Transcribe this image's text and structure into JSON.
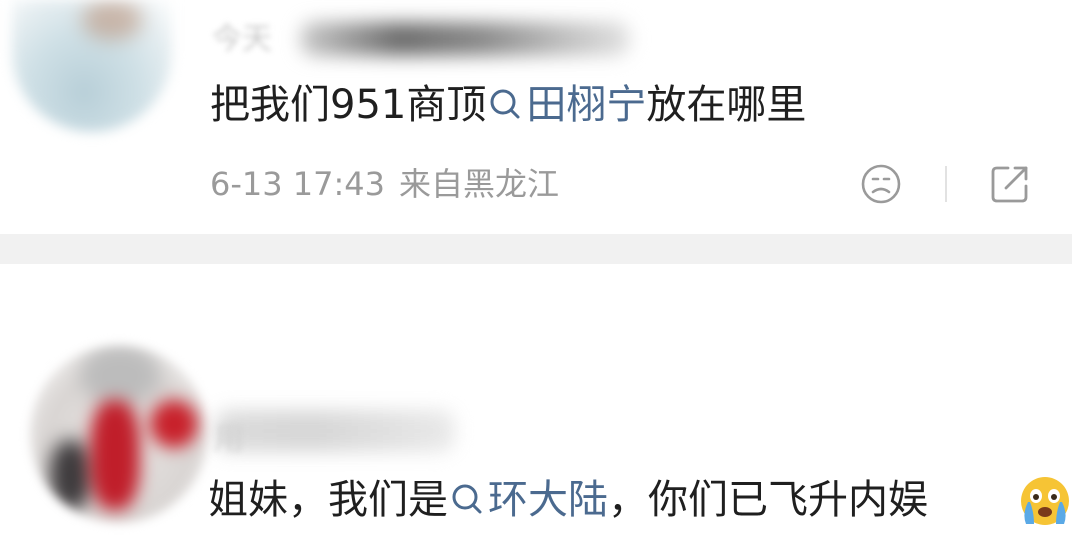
{
  "comments": [
    {
      "username_blurred": "今天",
      "text_before": "把我们951商顶",
      "topic": "田栩宁",
      "text_after": "放在哪里",
      "timestamp": "6-13 17:43",
      "location": "来自黑龙江"
    },
    {
      "username_blurred": "用",
      "text_before": "姐妹，我们是",
      "topic": "环大陆",
      "text_after": "，你们已飞升内娱"
    }
  ],
  "icons": {
    "topic": "search-icon",
    "reaction": "sad-face-icon",
    "share": "share-icon",
    "emoji": "crying-face-emoji"
  },
  "colors": {
    "topic_link": "#4b6a8f",
    "meta_text": "#9a9a9a",
    "body_text": "#1f1f1f",
    "separator": "#f1f1f1"
  }
}
